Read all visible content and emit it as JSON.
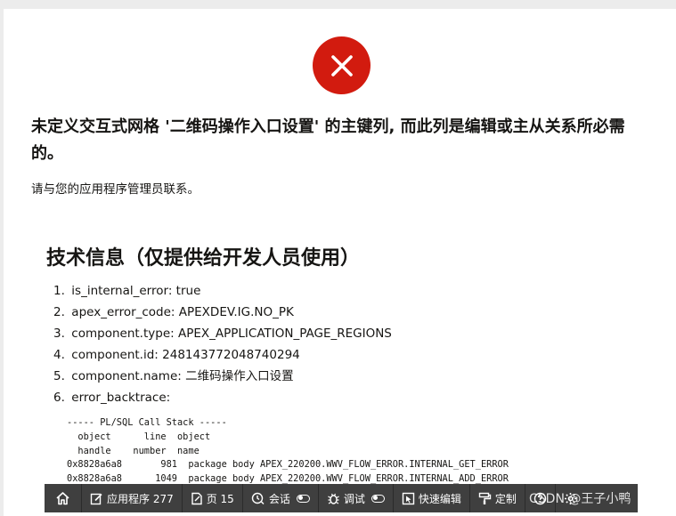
{
  "error": {
    "title": "未定义交互式网格 '二维码操作入口设置' 的主键列, 而此列是编辑或主从关系所必需的。",
    "message": "请与您的应用程序管理员联系。"
  },
  "technical_info": {
    "heading": "技术信息（仅提供给开发人员使用）",
    "items": [
      {
        "num": "1.",
        "key": "is_internal_error:",
        "value": "true"
      },
      {
        "num": "2.",
        "key": "apex_error_code:",
        "value": "APEXDEV.IG.NO_PK"
      },
      {
        "num": "3.",
        "key": "component.type:",
        "value": "APEX_APPLICATION_PAGE_REGIONS"
      },
      {
        "num": "4.",
        "key": "component.id:",
        "value": "2481437720487402​94"
      },
      {
        "num": "5.",
        "key": "component.name:",
        "value": "二维码操作入口设置"
      },
      {
        "num": "6.",
        "key": "error_backtrace:",
        "value": ""
      }
    ],
    "stack_lines": [
      "----- PL/SQL Call Stack -----",
      "  object      line  object",
      "  handle    number  name",
      "0x8828a6a8       981  package body APEX_220200.WWV_FLOW_ERROR.INTERNAL_GET_ERROR",
      "0x8828a6a8      1049  package body APEX_220200.WWV_FLOW_ERROR.INTERNAL_ADD_ERROR"
    ]
  },
  "toolbar": {
    "app_label": "应用程序 277",
    "page_label": "页 15",
    "session_label": "会话",
    "debug_label": "调试",
    "quick_edit_label": "快速编辑",
    "customize_label": "定制"
  },
  "watermark": "CSDN @王子小鸭",
  "colors": {
    "error_red": "#d21b0f",
    "toolbar_bg": "#3f3f3f",
    "text": "#161513"
  }
}
